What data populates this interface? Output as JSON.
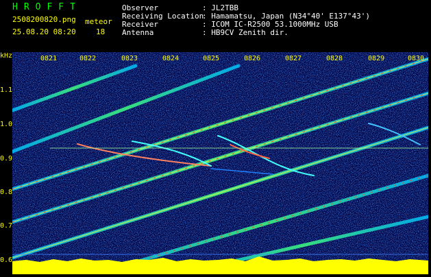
{
  "header": {
    "brand": "HROFFT",
    "filename": "2508200820.png",
    "meteor_label": "meteor",
    "datetime": "25.08.20 08:20",
    "meteor_count": "18",
    "info": [
      {
        "label": "Observer",
        "value": ": JL2TBB"
      },
      {
        "label": "Receiving Location",
        "value": ": Hamamatsu, Japan (N34°40' E137°43')"
      },
      {
        "label": "Receiver",
        "value": ": ICOM IC-R2500 53.1000MHz USB"
      },
      {
        "label": "Antenna",
        "value": ": HB9CV Zenith dir."
      }
    ]
  },
  "spectrogram": {
    "unit": "kHz",
    "time_ticks": [
      "0821",
      "0822",
      "0823",
      "0824",
      "0825",
      "0826",
      "0827",
      "0828",
      "0829",
      "0830"
    ],
    "freq_ticks": [
      "1.1",
      "1.0",
      "0.9",
      "0.8",
      "0.7",
      "0.6"
    ],
    "colors": {
      "background": "#000040",
      "noise": "#1030c0",
      "signal": "#00ffff",
      "hot": "#ff4020",
      "baseline": "#ffff00"
    }
  }
}
